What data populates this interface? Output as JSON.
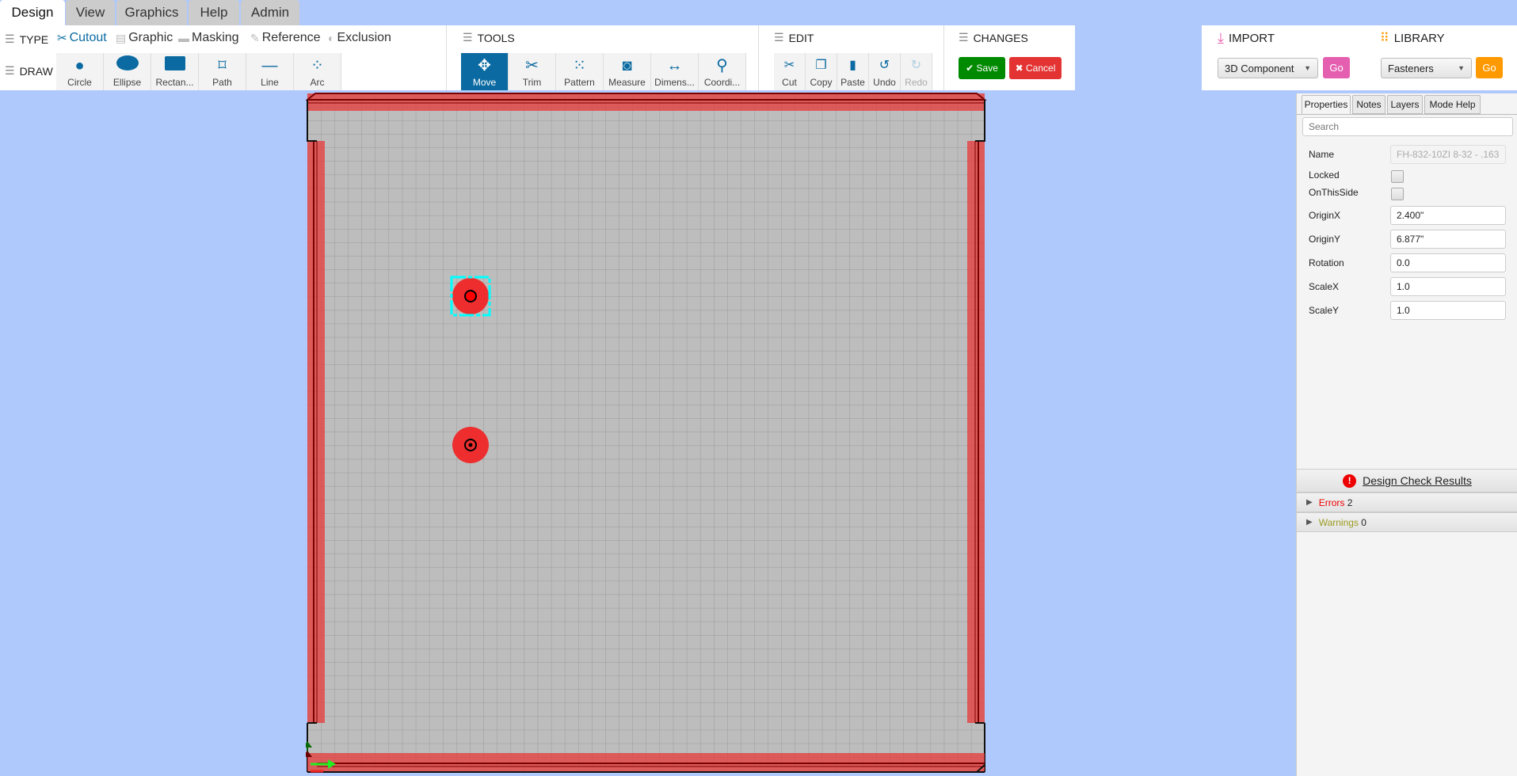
{
  "menu_tabs": [
    "Design",
    "View",
    "Graphics",
    "Help",
    "Admin"
  ],
  "type_section": {
    "label": "TYPE",
    "items": [
      {
        "label": "Cutout",
        "icon": "scissors-icon",
        "active": true
      },
      {
        "label": "Graphic",
        "icon": "image-file-icon"
      },
      {
        "label": "Masking",
        "icon": "masking-tape-icon"
      },
      {
        "label": "Reference",
        "icon": "edit-icon"
      },
      {
        "label": "Exclusion",
        "icon": "half-circle-icon"
      }
    ]
  },
  "draw_section": {
    "label": "DRAW",
    "items": [
      {
        "label": "Circle",
        "icon": "circle-icon"
      },
      {
        "label": "Ellipse",
        "icon": "ellipse-icon"
      },
      {
        "label": "Rectan...",
        "icon": "rectangle-icon"
      },
      {
        "label": "Path",
        "icon": "path-icon"
      },
      {
        "label": "Line",
        "icon": "line-icon"
      },
      {
        "label": "Arc",
        "icon": "arc-icon"
      }
    ]
  },
  "tools_section": {
    "label": "TOOLS",
    "items": [
      {
        "label": "Move",
        "icon": "move-icon",
        "active": true
      },
      {
        "label": "Trim",
        "icon": "scissors-icon"
      },
      {
        "label": "Pattern",
        "icon": "pattern-dots-icon"
      },
      {
        "label": "Measure",
        "icon": "tape-measure-icon"
      },
      {
        "label": "Dimens...",
        "icon": "dimension-arrows-icon"
      },
      {
        "label": "Coordi...",
        "icon": "map-pin-icon"
      }
    ]
  },
  "edit_section": {
    "label": "EDIT",
    "items": [
      {
        "label": "Cut",
        "icon": "scissors-icon"
      },
      {
        "label": "Copy",
        "icon": "copy-icon"
      },
      {
        "label": "Paste",
        "icon": "paste-icon"
      },
      {
        "label": "Undo",
        "icon": "undo-icon"
      },
      {
        "label": "Redo",
        "icon": "redo-icon",
        "disabled": true
      }
    ]
  },
  "changes_section": {
    "label": "CHANGES",
    "save": "Save",
    "cancel": "Cancel"
  },
  "import": {
    "label": "IMPORT",
    "selected": "3D Component",
    "go": "Go",
    "color": "#e55fb0"
  },
  "library": {
    "label": "LIBRARY",
    "selected": "Fasteners",
    "go": "Go",
    "color": "#ff9900"
  },
  "panel": {
    "tabs": [
      "Properties",
      "Notes",
      "Layers",
      "Mode Help"
    ],
    "search_placeholder": "Search",
    "props": {
      "name_label": "Name",
      "name_value": "FH-832-10ZI 8-32 - .163",
      "locked_label": "Locked",
      "locked": false,
      "onthisside_label": "OnThisSide",
      "onthisside": false,
      "originx_label": "OriginX",
      "originx": "2.400\"",
      "originy_label": "OriginY",
      "originy": "6.877\"",
      "rotation_label": "Rotation",
      "rotation": "0.0",
      "scalex_label": "ScaleX",
      "scalex": "1.0",
      "scaley_label": "ScaleY",
      "scaley": "1.0"
    },
    "design_check": {
      "title": "Design Check Results",
      "errors_label": "Errors",
      "errors": "2",
      "warnings_label": "Warnings",
      "warnings": "0"
    }
  },
  "colors": {
    "accent": "#0a6aa1",
    "cutout_red": "#e83a3a",
    "selection": "#00ffff",
    "save": "#008a00",
    "cancel": "#e43333"
  }
}
